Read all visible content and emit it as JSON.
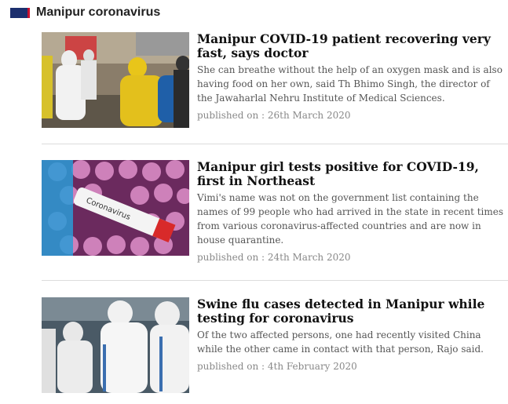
{
  "section": {
    "title": "Manipur coronavirus"
  },
  "articles": [
    {
      "headline": "Manipur COVID-19 patient recovering very fast, says doctor",
      "summary": "She can breathe without the help of an oxygen mask and is also having food on her own, said Th Bhimo Singh, the director of the Jawaharlal Nehru Institute of Medical Sciences.",
      "published": "published on : 26th March 2020",
      "image_icon": "hazmat-workers-photo"
    },
    {
      "headline": "Manipur girl tests positive for COVID-19, first in Northeast",
      "summary": "Vimi's name was not on the government list containing the names of 99 people who had arrived in the state in recent times from various coronavirus-affected countries and are now in house quarantine.",
      "published": "published on : 24th March 2020",
      "image_icon": "test-tube-photo",
      "image_text": "Coronavirus"
    },
    {
      "headline": "Swine flu cases detected in Manipur while testing for coronavirus",
      "summary": "Of the two affected persons, one had recently visited China while the other came in contact with that person, Rajo said.",
      "published": "published on : 4th February 2020",
      "image_icon": "medical-staff-photo"
    }
  ],
  "colors": {
    "flag_blue": "#1c2f6e",
    "flag_red": "#c8102e"
  }
}
